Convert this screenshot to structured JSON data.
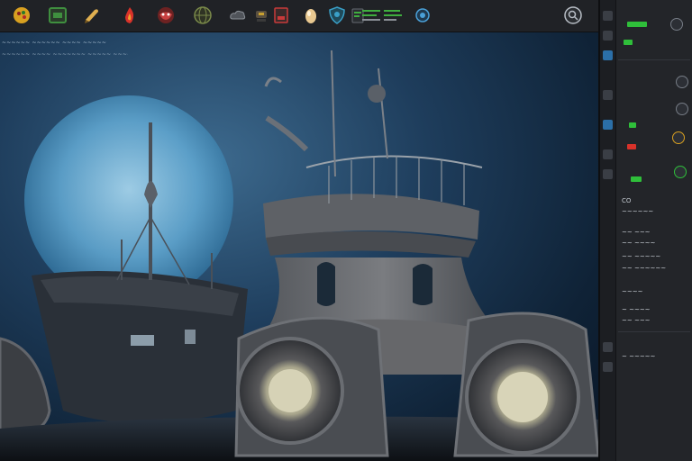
{
  "app": {
    "accent": "#2fbf3a",
    "toolbar_icons": [
      {
        "name": "palette-icon",
        "color": "#d8a020"
      },
      {
        "name": "image-icon",
        "color": "#3f8f3f"
      },
      {
        "name": "brush-icon",
        "color": "#e0b050"
      },
      {
        "name": "fire-icon",
        "color": "#d8322a"
      },
      {
        "name": "mask-icon",
        "color": "#c84040"
      },
      {
        "name": "globe-icon",
        "color": "#7a8a4a"
      },
      {
        "name": "cloud-icon",
        "color": "#8a8f96"
      },
      {
        "name": "lamp-icon",
        "color": "#c8a030"
      },
      {
        "name": "card-icon",
        "color": "#c83a3a"
      },
      {
        "name": "egg-icon",
        "color": "#e8c890"
      },
      {
        "name": "shield-icon",
        "color": "#3aa0c8"
      },
      {
        "name": "layers-icon",
        "color": "#3fae3f"
      },
      {
        "name": "sliders-icon",
        "color": "#3fae3f"
      },
      {
        "name": "circle-icon",
        "color": "#4aa0d8"
      },
      {
        "name": "search-icon",
        "color": "#b8bec6"
      }
    ]
  },
  "canvas": {
    "caption_lines": [
      "~~~~~~ ~~~~~~ ~~~~ ~~~~~",
      "~~~~~~ ~~~~ ~~~~~~~ ~~~~~ ~~~~~~~~~~~~ ~~~~~~~~~~"
    ]
  },
  "panel": {
    "rows": [
      {
        "label": "CO"
      },
      {
        "label": "~~~~~~"
      },
      {
        "label": "~~ ~~~"
      },
      {
        "label": "~~ ~~~~"
      },
      {
        "label": "~~ ~~~~~"
      },
      {
        "label": "~~ ~~~~~~"
      },
      {
        "label": "~~~~"
      },
      {
        "label": "~ ~~~~"
      },
      {
        "label": "~~ ~~~"
      },
      {
        "label": "~ ~~~~~"
      }
    ]
  }
}
